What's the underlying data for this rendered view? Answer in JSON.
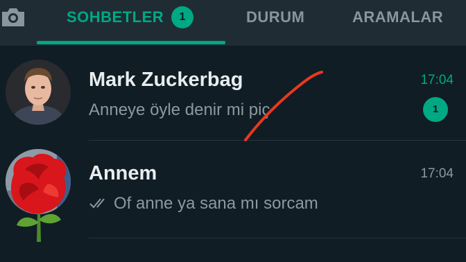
{
  "tabs": {
    "camera_icon": "camera-icon",
    "items": [
      {
        "label": "SOHBETLER",
        "active": true,
        "badge": "1"
      },
      {
        "label": "DURUM",
        "active": false
      },
      {
        "label": "ARAMALAR",
        "active": false
      }
    ]
  },
  "chats": [
    {
      "name": "Mark Zuckerbag",
      "preview": "Anneye öyle denir mi piç",
      "time": "17:04",
      "unread_count": "1"
    },
    {
      "name": "Annem",
      "preview": "Of anne ya sana mı sorcam",
      "time": "17:04",
      "status_icon": "double-check-icon"
    }
  ],
  "colors": {
    "accent": "#00a884",
    "background": "#101d25",
    "header": "#1f2c34",
    "scribble": "#e8381e"
  }
}
